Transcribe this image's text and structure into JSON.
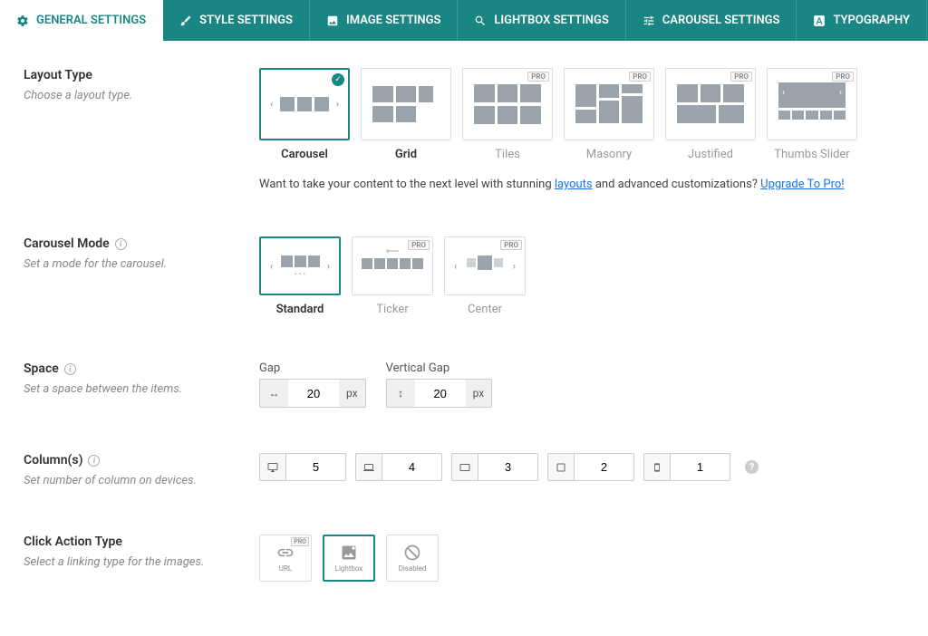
{
  "tabs": [
    {
      "label": "GENERAL SETTINGS"
    },
    {
      "label": "STYLE SETTINGS"
    },
    {
      "label": "IMAGE SETTINGS"
    },
    {
      "label": "LIGHTBOX SETTINGS"
    },
    {
      "label": "CAROUSEL SETTINGS"
    },
    {
      "label": "TYPOGRAPHY"
    }
  ],
  "layout": {
    "title": "Layout Type",
    "desc": "Choose a layout type.",
    "options": [
      "Carousel",
      "Grid",
      "Tiles",
      "Masonry",
      "Justified",
      "Thumbs Slider"
    ],
    "upsell_pre": "Want to take your content to the next level with stunning ",
    "upsell_link1": "layouts",
    "upsell_mid": " and advanced customizations? ",
    "upsell_link2": "Upgrade To Pro!"
  },
  "mode": {
    "title": "Carousel Mode",
    "desc": "Set a mode for the carousel.",
    "options": [
      "Standard",
      "Ticker",
      "Center"
    ]
  },
  "space": {
    "title": "Space",
    "desc": "Set a space between the items.",
    "gap_label": "Gap",
    "vgap_label": "Vertical Gap",
    "gap_value": "20",
    "vgap_value": "20",
    "unit": "px"
  },
  "columns": {
    "title": "Column(s)",
    "desc": "Set number of column on devices.",
    "values": [
      "5",
      "4",
      "3",
      "2",
      "1"
    ]
  },
  "click": {
    "title": "Click Action Type",
    "desc": "Select a linking type for the images.",
    "options": [
      "URL",
      "Lightbox",
      "Disabled"
    ]
  },
  "pro_badge": "PRO"
}
